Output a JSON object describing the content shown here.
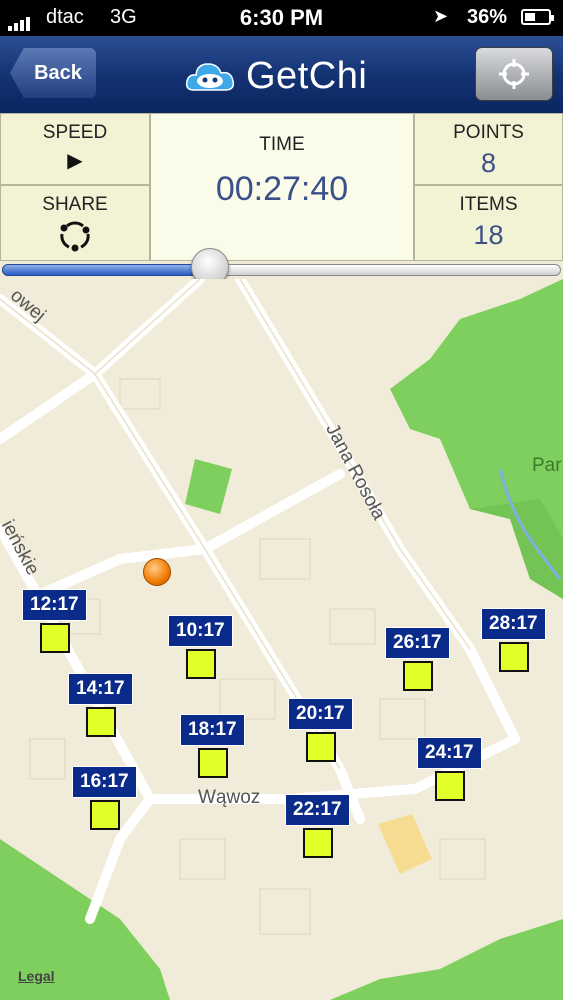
{
  "status_bar": {
    "carrier": "dtac",
    "network": "3G",
    "time": "6:30 PM",
    "battery": "36%"
  },
  "nav": {
    "back_label": "Back",
    "title": "GetChi"
  },
  "stats": {
    "speed_label": "SPEED",
    "speed_icon": "▶",
    "share_label": "SHARE",
    "time_label": "TIME",
    "time_value": "00:27:40",
    "points_label": "POINTS",
    "points_value": "8",
    "items_label": "ITEMS",
    "items_value": "18"
  },
  "slider": {
    "value_fraction": 0.37
  },
  "map": {
    "street_labels": [
      "owej",
      "Jana Rosoła",
      "ieńskie",
      "Wąwoz",
      "Par"
    ],
    "legal_label": "Legal",
    "markers": [
      "12:17",
      "10:17",
      "14:17",
      "18:17",
      "20:17",
      "16:17",
      "22:17",
      "26:17",
      "24:17",
      "28:17"
    ]
  },
  "colors": {
    "navbar": "#143373",
    "tag": "#0a2b8a",
    "marker_box": "#e2ff2a",
    "park": "#7fcf5e",
    "map_background": "#f1ecd9"
  }
}
